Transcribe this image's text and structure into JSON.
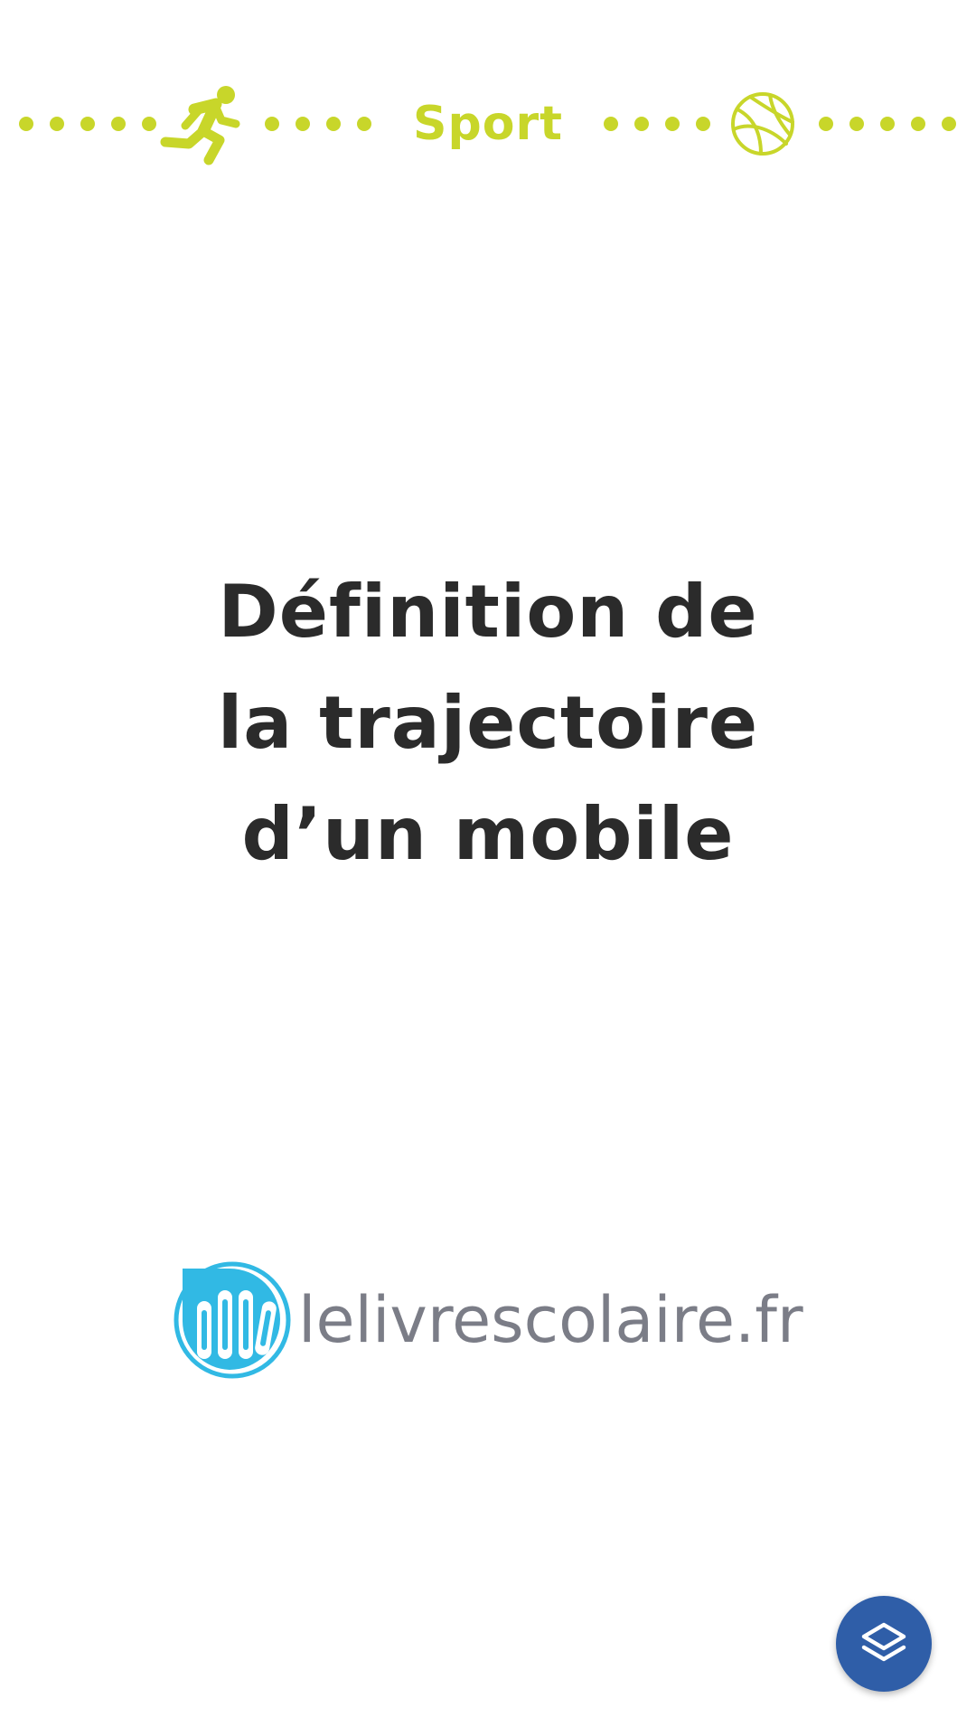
{
  "header": {
    "label": "Sport",
    "left_icon": "running-person-icon",
    "right_icon": "basketball-icon",
    "accent_color": "#c8d62a"
  },
  "title": {
    "lines": [
      "Définition de",
      "la trajectoire",
      "d’un mobile"
    ],
    "color": "#2b2b2b"
  },
  "brand": {
    "name": "lelivrescolaire.fr",
    "logo_icon": "books-logo-icon",
    "name_color": "#7b7d87",
    "logo_color": "#31b9e4"
  },
  "fab": {
    "icon": "layers-icon",
    "color": "#2f5ea8"
  }
}
